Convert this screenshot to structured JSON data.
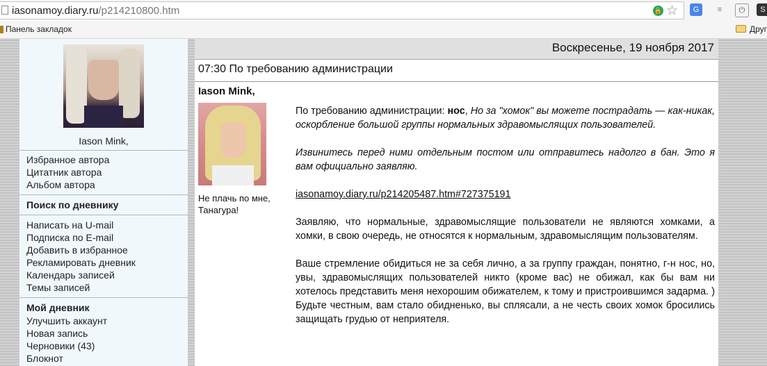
{
  "browser": {
    "url_host": "iasonamoy.diary.ru",
    "url_path": "/p214210800.htm",
    "bookmarks_label": "Панель закладок",
    "other_bookmarks_label": "Другие"
  },
  "sidebar": {
    "user_name": "Iason Mink,",
    "links_group1": [
      "Избранное автора",
      "Цитатник автора",
      "Альбом автора"
    ],
    "search_heading": "Поиск по дневнику",
    "links_group2": [
      "Написать на U-mail",
      "Подписка по E-mail",
      "Добавить в избранное",
      "Рекламировать дневник",
      "Календарь записей",
      "Темы записей"
    ],
    "my_diary_heading": "Мой дневник",
    "links_group3": [
      "Улучшить аккаунт",
      "Новая запись",
      "Черновики (43)",
      "Блокнот"
    ]
  },
  "post": {
    "date": "Воскресенье, 19 ноября 2017",
    "title": "07:30 По требованию администрации",
    "author": "Iason Mink,",
    "author_caption": "Не плачь по мне, Танагура!",
    "p1_lead": "По требованию администрации: ",
    "p1_bold": "нос",
    "p1_comma": ", ",
    "p1_italic": "Но за \"хомок\" вы можете пострадать — как-никак, оскорбление большой группы нормальных здравомыслящих пользователей.",
    "p2_italic": "Извинитесь перед ними отдельным постом или отправитесь надолго в бан. Это я вам официально заявляю.",
    "p3_link": "iasonamoy.diary.ru/p214205487.htm#727375191",
    "p4": "Заявляю, что нормальные, здравомыслящие пользователи не являются хомками, а хомки, в свою очередь, не относятся к нормальным, здравомыслящим пользователям.",
    "p5": "Ваше стремление обидиться не за себя лично, а за группу граждан, понятно, г-н нос, но, увы, здравомыслящих пользователей никто (кроме вас) не обижал, как бы вам ни хотелось представить меня нехорошим обижателем, к тому и пристроившимся задарма. ) Будьте честным, вам стало обидненько, вы сплясали, а не честь своих хомок бросились защищать грудью от неприятеля."
  }
}
